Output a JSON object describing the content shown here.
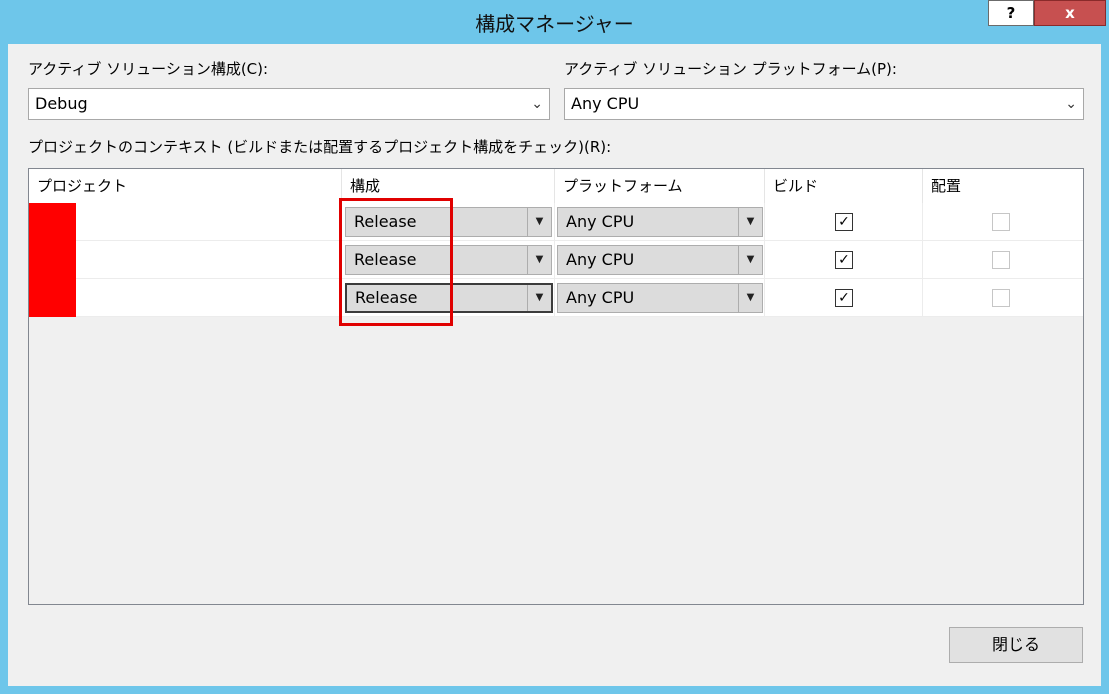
{
  "window": {
    "title": "構成マネージャー",
    "help_label": "?",
    "close_label": "x"
  },
  "active_config": {
    "label": "アクティブ ソリューション構成(C):",
    "value": "Debug"
  },
  "active_platform": {
    "label": "アクティブ ソリューション プラットフォーム(P):",
    "value": "Any CPU"
  },
  "context": {
    "label": "プロジェクトのコンテキスト (ビルドまたは配置するプロジェクト構成をチェック)(R):"
  },
  "columns": [
    "プロジェクト",
    "構成",
    "プラットフォーム",
    "ビルド",
    "配置"
  ],
  "rows": [
    {
      "config": "Release",
      "platform": "Any CPU",
      "build": true,
      "deploy": false
    },
    {
      "config": "Release",
      "platform": "Any CPU",
      "build": true,
      "deploy": false
    },
    {
      "config": "Release",
      "platform": "Any CPU",
      "build": true,
      "deploy": false
    }
  ],
  "close_button": "閉じる",
  "colors": {
    "highlight": "#e00000",
    "redaction": "#ff0000",
    "titlebar": "#6ec6ea"
  }
}
